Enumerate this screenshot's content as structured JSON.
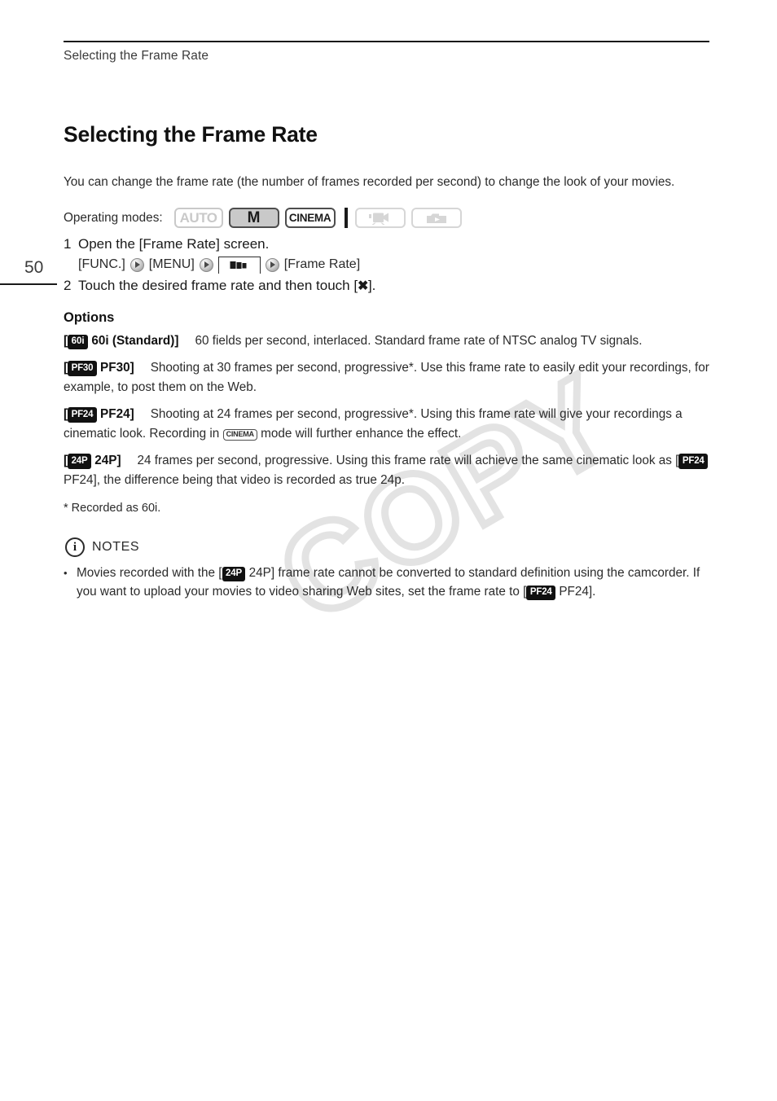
{
  "page": {
    "running_head": "Selecting the Frame Rate",
    "page_number": "50",
    "watermark": "COPY"
  },
  "title": "Selecting the Frame Rate",
  "intro": "You can change the frame rate (the number of frames recorded per second) to change the look of your movies.",
  "operating_modes": {
    "label": "Operating modes:",
    "badges": [
      {
        "name": "auto-mode-badge",
        "text": "AUTO",
        "state": "inactive"
      },
      {
        "name": "manual-mode-badge",
        "text": "M",
        "state": "active"
      },
      {
        "name": "cinema-mode-badge",
        "text": "CINEMA",
        "state": "active"
      },
      {
        "name": "movie-playback-mode-badge",
        "icon": "movie-camera-icon",
        "state": "inactive"
      },
      {
        "name": "photo-playback-mode-badge",
        "icon": "photo-playback-icon",
        "state": "inactive"
      }
    ]
  },
  "steps": [
    {
      "number": "1",
      "text": "Open the [Frame Rate] screen.",
      "path": {
        "func": "[FUNC.]",
        "menu": "[MENU]",
        "tab_icon": "camera-setup-tab-icon",
        "target": "[Frame Rate]"
      }
    },
    {
      "number": "2",
      "text_before": "Touch the desired frame rate and then touch [",
      "x_glyph": "✖",
      "text_after": "]."
    }
  ],
  "options": {
    "heading": "Options",
    "items": [
      {
        "pill": "60i",
        "term_open": "[",
        "term_label": "60i (Standard)]",
        "description": "60 fields per second, interlaced. Standard frame rate of NTSC analog TV signals."
      },
      {
        "pill": "PF30",
        "term_open": "[",
        "term_label": "PF30]",
        "description": "Shooting at 30 frames per second, progressive*. Use this frame rate to easily edit your recordings, for example, to post them on the Web."
      },
      {
        "pill": "PF24",
        "term_open": "[",
        "term_label": "PF24]",
        "description_part1": "Shooting at 24 frames per second, progressive*. Using this frame rate will give your recordings a cinematic look. Recording in ",
        "inline_chip": "CINEMA",
        "description_part2": " mode will further enhance the effect."
      },
      {
        "pill": "24P",
        "term_open": "[",
        "term_label": "24P]",
        "description_part1": "24 frames per second, progressive. Using this frame rate will achieve the same cinematic look as [",
        "inline_pill": "PF24",
        "description_part2": " PF24], the difference being that video is recorded as true 24p."
      }
    ]
  },
  "footnote": "* Recorded as 60i.",
  "notes": {
    "icon": "info-icon",
    "label": "NOTES",
    "items": [
      {
        "bullet": "•",
        "part1": "Movies recorded with the [",
        "pill1": "24P",
        "part2": " 24P] frame rate cannot be converted to standard definition using the camcorder. If you want to upload your movies to video sharing Web sites, set the frame rate to [",
        "pill2": "PF24",
        "part3": " PF24]."
      }
    ]
  }
}
